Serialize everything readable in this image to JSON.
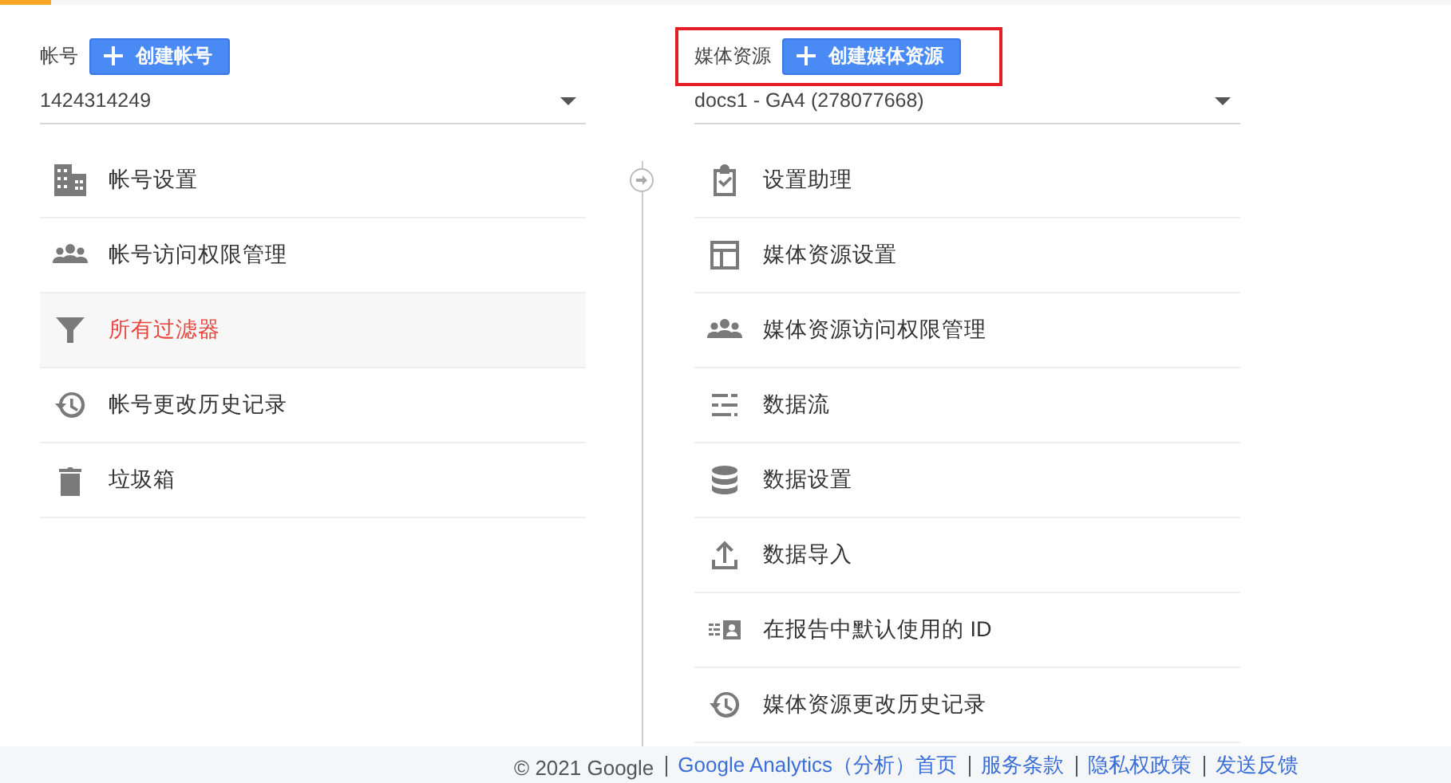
{
  "account": {
    "label": "帐号",
    "create_button": "创建帐号",
    "selector_value": "1424314249",
    "highlighted": false,
    "items": [
      {
        "label": "帐号设置",
        "selected": false
      },
      {
        "label": "帐号访问权限管理",
        "selected": false
      },
      {
        "label": "所有过滤器",
        "selected": true
      },
      {
        "label": "帐号更改历史记录",
        "selected": false
      },
      {
        "label": "垃圾箱",
        "selected": false
      }
    ]
  },
  "property": {
    "label": "媒体资源",
    "create_button": "创建媒体资源",
    "selector_value": "docs1 - GA4 (278077668)",
    "highlighted": true,
    "items": [
      {
        "label": "设置助理",
        "selected": false
      },
      {
        "label": "媒体资源设置",
        "selected": false
      },
      {
        "label": "媒体资源访问权限管理",
        "selected": false
      },
      {
        "label": "数据流",
        "selected": false
      },
      {
        "label": "数据设置",
        "selected": false
      },
      {
        "label": "数据导入",
        "selected": false
      },
      {
        "label": "在报告中默认使用的 ID",
        "selected": false
      },
      {
        "label": "媒体资源更改历史记录",
        "selected": false
      }
    ]
  },
  "footer": {
    "copyright": "© 2021 Google",
    "links": [
      "Google Analytics（分析）首页",
      "服务条款",
      "隐私权政策",
      "发送反馈"
    ]
  }
}
